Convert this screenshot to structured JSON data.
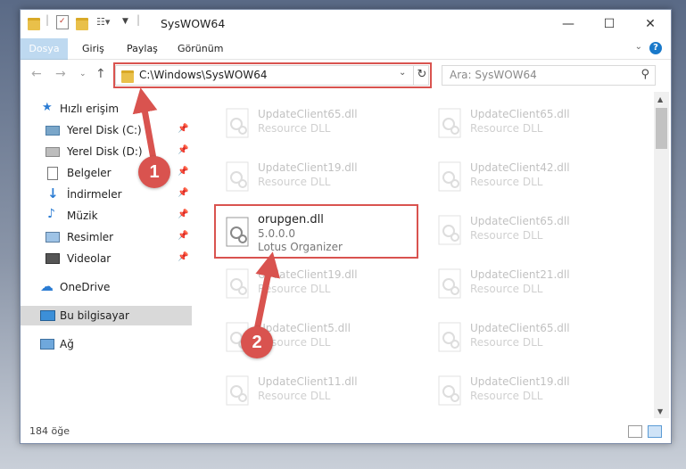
{
  "window": {
    "title": "SysWOW64",
    "controls": {
      "minimize": "—",
      "maximize": "☐",
      "close": "✕"
    }
  },
  "ribbon": {
    "tabs": [
      "Dosya",
      "Giriş",
      "Paylaş",
      "Görünüm"
    ],
    "help": "?"
  },
  "navigation": {
    "address": "C:\\Windows\\SysWOW64",
    "search_placeholder": "Ara: SysWOW64"
  },
  "sidebar": {
    "items": [
      {
        "label": "Hızlı erişim",
        "icon": "star-icon",
        "pinned": false
      },
      {
        "label": "Yerel Disk (C:)",
        "icon": "drive-icon",
        "pinned": true
      },
      {
        "label": "Yerel Disk (D:)",
        "icon": "drive-icon",
        "pinned": true
      },
      {
        "label": "Belgeler",
        "icon": "documents-icon",
        "pinned": true
      },
      {
        "label": "İndirmeler",
        "icon": "download-icon",
        "pinned": true
      },
      {
        "label": "Müzik",
        "icon": "music-icon",
        "pinned": true
      },
      {
        "label": "Resimler",
        "icon": "pictures-icon",
        "pinned": true
      },
      {
        "label": "Videolar",
        "icon": "videos-icon",
        "pinned": true
      },
      {
        "label": "OneDrive",
        "icon": "cloud-icon",
        "pinned": false
      },
      {
        "label": "Bu bilgisayar",
        "icon": "computer-icon",
        "pinned": false,
        "selected": true
      },
      {
        "label": "Ağ",
        "icon": "network-icon",
        "pinned": false
      }
    ]
  },
  "files": {
    "left": [
      {
        "name": "UpdateClient65.dll",
        "desc": "Resource DLL"
      },
      {
        "name": "UpdateClient19.dll",
        "desc": "Resource DLL"
      },
      {
        "name": "orupgen.dll",
        "version": "5.0.0.0",
        "desc": "Lotus Organizer",
        "highlighted": true
      },
      {
        "name": "UpdateClient19.dll",
        "desc": "Resource DLL"
      },
      {
        "name": "UpdateClient5.dll",
        "desc": "Resource DLL"
      },
      {
        "name": "UpdateClient11.dll",
        "desc": "Resource DLL"
      }
    ],
    "right": [
      {
        "name": "UpdateClient65.dll",
        "desc": "Resource DLL"
      },
      {
        "name": "UpdateClient42.dll",
        "desc": "Resource DLL"
      },
      {
        "name": "UpdateClient65.dll",
        "desc": "Resource DLL"
      },
      {
        "name": "UpdateClient21.dll",
        "desc": "Resource DLL"
      },
      {
        "name": "UpdateClient65.dll",
        "desc": "Resource DLL"
      },
      {
        "name": "UpdateClient19.dll",
        "desc": "Resource DLL"
      }
    ]
  },
  "status": {
    "count": "184 öğe"
  },
  "annotations": {
    "step1": "1",
    "step2": "2",
    "color": "#d9534f"
  }
}
